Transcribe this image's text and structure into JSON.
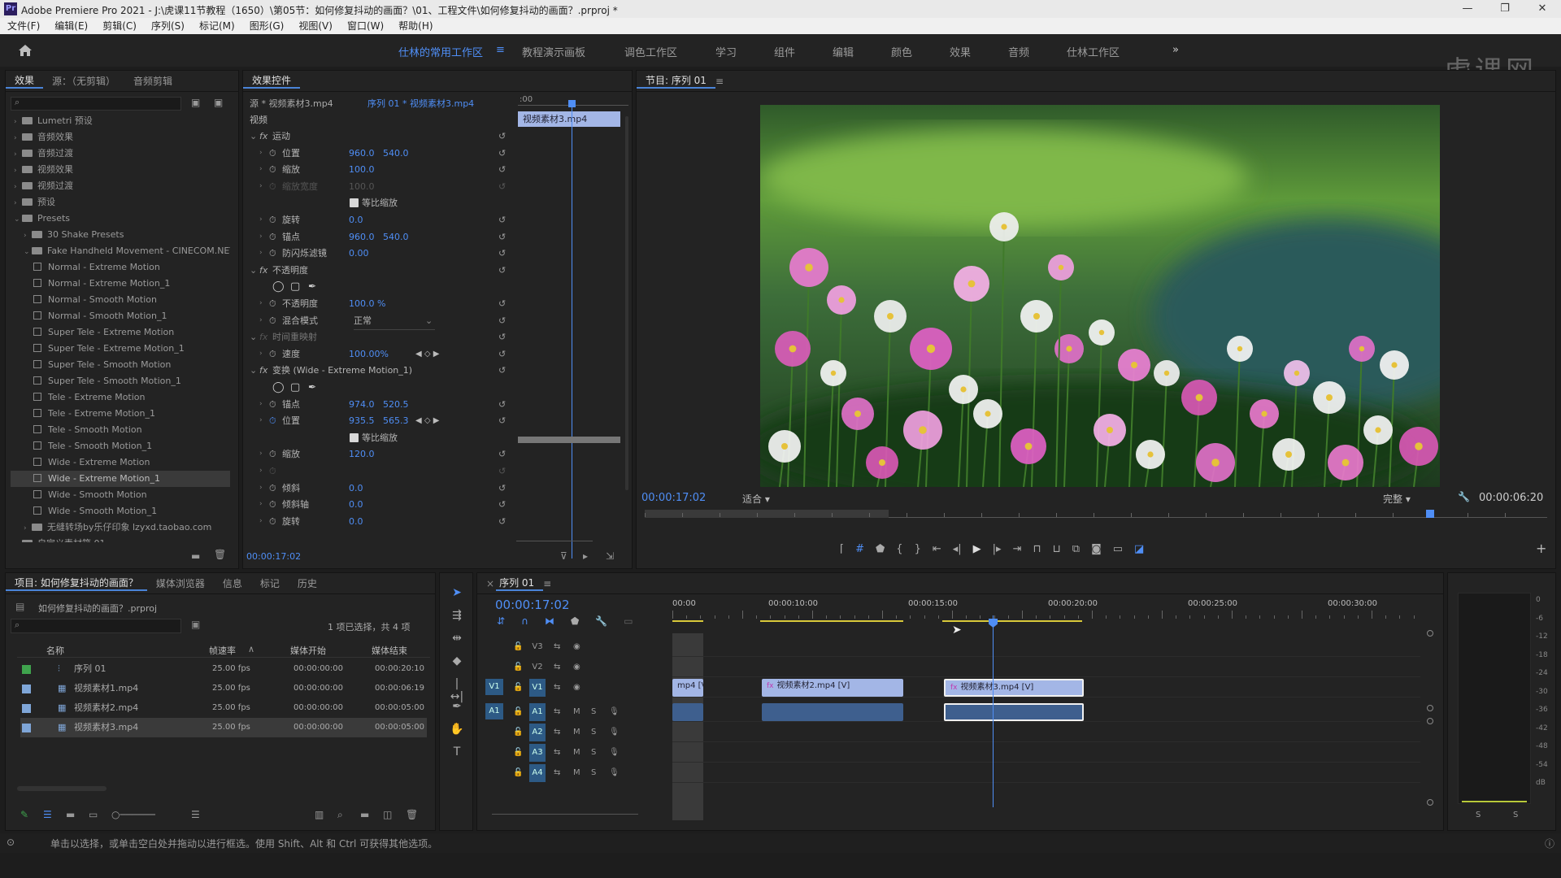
{
  "titlebar": {
    "app_icon": "Pr",
    "title": "Adobe Premiere Pro 2021 - J:\\虎课11节教程（1650）\\第05节：如何修复抖动的画面？\\01、工程文件\\如何修复抖动的画面？.prproj *",
    "controls": [
      "—",
      "❐",
      "✕"
    ]
  },
  "menu": [
    "文件(F)",
    "编辑(E)",
    "剪辑(C)",
    "序列(S)",
    "标记(M)",
    "图形(G)",
    "视图(V)",
    "窗口(W)",
    "帮助(H)"
  ],
  "workspaces": {
    "items": [
      "仕林的常用工作区",
      "教程演示画板",
      "调色工作区",
      "学习",
      "组件",
      "编辑",
      "颜色",
      "效果",
      "音频",
      "仕林工作区"
    ],
    "active": "仕林的常用工作区",
    "more": "»"
  },
  "watermark": "虎课网",
  "effects_panel": {
    "tabs": [
      "效果",
      "源：（无剪辑）",
      "音频剪辑"
    ],
    "tree": [
      {
        "label": "Lumetri 预设",
        "level": 0,
        "type": "folder"
      },
      {
        "label": "音频效果",
        "level": 0,
        "type": "folder"
      },
      {
        "label": "音频过渡",
        "level": 0,
        "type": "folder"
      },
      {
        "label": "视频效果",
        "level": 0,
        "type": "folder"
      },
      {
        "label": "视频过渡",
        "level": 0,
        "type": "folder"
      },
      {
        "label": "预设",
        "level": 0,
        "type": "folder"
      },
      {
        "label": "Presets",
        "level": 0,
        "type": "folder",
        "open": true
      },
      {
        "label": "30 Shake Presets",
        "level": 1,
        "type": "folder"
      },
      {
        "label": "Fake Handheld Movement - CINECOM.NET",
        "level": 1,
        "type": "folder",
        "open": true
      },
      {
        "label": "Normal - Extreme Motion",
        "level": 2,
        "type": "preset"
      },
      {
        "label": "Normal - Extreme Motion_1",
        "level": 2,
        "type": "preset"
      },
      {
        "label": "Normal - Smooth Motion",
        "level": 2,
        "type": "preset"
      },
      {
        "label": "Normal - Smooth Motion_1",
        "level": 2,
        "type": "preset"
      },
      {
        "label": "Super Tele - Extreme Motion",
        "level": 2,
        "type": "preset"
      },
      {
        "label": "Super Tele - Extreme Motion_1",
        "level": 2,
        "type": "preset"
      },
      {
        "label": "Super Tele - Smooth Motion",
        "level": 2,
        "type": "preset"
      },
      {
        "label": "Super Tele - Smooth Motion_1",
        "level": 2,
        "type": "preset"
      },
      {
        "label": "Tele - Extreme Motion",
        "level": 2,
        "type": "preset"
      },
      {
        "label": "Tele - Extreme Motion_1",
        "level": 2,
        "type": "preset"
      },
      {
        "label": "Tele - Smooth Motion",
        "level": 2,
        "type": "preset"
      },
      {
        "label": "Tele - Smooth Motion_1",
        "level": 2,
        "type": "preset"
      },
      {
        "label": "Wide - Extreme Motion",
        "level": 2,
        "type": "preset"
      },
      {
        "label": "Wide - Extreme Motion_1",
        "level": 2,
        "type": "preset",
        "selected": true
      },
      {
        "label": "Wide - Smooth Motion",
        "level": 2,
        "type": "preset"
      },
      {
        "label": "Wide - Smooth Motion_1",
        "level": 2,
        "type": "preset"
      },
      {
        "label": "无缝转场by乐仔印象 lzyxd.taobao.com",
        "level": 1,
        "type": "folder"
      },
      {
        "label": "自定义素材箱 01",
        "level": 0,
        "type": "folder"
      }
    ]
  },
  "effect_controls": {
    "tab": "效果控件",
    "source_label": "源 * 视频素材3.mp4",
    "sequence_label": "序列 01 * 视频素材3.mp4",
    "ruler_start": ":00",
    "clip_label": "视频素材3.mp4",
    "section_video": "视频",
    "timecode": "00:00:17:02",
    "rows": [
      {
        "label": "运动",
        "fx": true,
        "indent": 0
      },
      {
        "label": "位置",
        "v1": "960.0",
        "v2": "540.0",
        "indent": 1
      },
      {
        "label": "缩放",
        "v1": "100.0",
        "indent": 1
      },
      {
        "label": "缩放宽度",
        "v1": "100.0",
        "indent": 1,
        "disabled": true
      },
      {
        "label": "等比缩放",
        "checkbox": true,
        "indent": 2
      },
      {
        "label": "旋转",
        "v1": "0.0",
        "indent": 1
      },
      {
        "label": "锚点",
        "v1": "960.0",
        "v2": "540.0",
        "indent": 1
      },
      {
        "label": "防闪烁滤镜",
        "v1": "0.00",
        "indent": 1
      },
      {
        "label": "不透明度",
        "fx": true,
        "indent": 0
      },
      {
        "label": "",
        "masks": true,
        "indent": 1
      },
      {
        "label": "不透明度",
        "v1": "100.0 %",
        "indent": 1
      },
      {
        "label": "混合模式",
        "select": "正常",
        "indent": 1
      },
      {
        "label": "时间重映射",
        "fx": true,
        "indent": 0,
        "dim": true
      },
      {
        "label": "速度",
        "v1": "100.00%",
        "indent": 1,
        "keyframe": true
      },
      {
        "label": "变换 (Wide - Extreme Motion_1)",
        "fx": true,
        "indent": 0
      },
      {
        "label": "",
        "masks": true,
        "indent": 1
      },
      {
        "label": "锚点",
        "v1": "974.0",
        "v2": "520.5",
        "indent": 1
      },
      {
        "label": "位置",
        "v1": "935.5",
        "v2": "565.3",
        "indent": 1,
        "keyframe": true,
        "animated": true
      },
      {
        "label": "等比缩放",
        "checkbox": true,
        "indent": 2
      },
      {
        "label": "缩放",
        "v1": "120.0",
        "indent": 1
      },
      {
        "label": "",
        "v1": "",
        "indent": 1,
        "disabled": true
      },
      {
        "label": "倾斜",
        "v1": "0.0",
        "indent": 1
      },
      {
        "label": "倾斜轴",
        "v1": "0.0",
        "indent": 1
      },
      {
        "label": "旋转",
        "v1": "0.0",
        "indent": 1
      }
    ]
  },
  "program_monitor": {
    "tab": "节目: 序列 01",
    "timecode": "00:00:17:02",
    "fit": "适合",
    "quality": "完整",
    "duration": "00:00:06:20",
    "playhead_fraction": 0.87
  },
  "project_panel": {
    "tabs": [
      "项目: 如何修复抖动的画面？",
      "媒体浏览器",
      "信息",
      "标记",
      "历史"
    ],
    "project_file": "如何修复抖动的画面？.prproj",
    "selection_info": "1 项已选择，共 4 项",
    "columns": [
      "名称",
      "帧速率",
      "媒体开始",
      "媒体结束"
    ],
    "rows": [
      {
        "color": "#3fa34d",
        "name": "序列 01",
        "fps": "25.00 fps",
        "start": "00:00:00:00",
        "end": "00:00:20:10",
        "kind": "sequence"
      },
      {
        "color": "#7fa6d8",
        "name": "视频素材1.mp4",
        "fps": "25.00 fps",
        "start": "00:00:00:00",
        "end": "00:00:06:19",
        "kind": "clip"
      },
      {
        "color": "#7fa6d8",
        "name": "视频素材2.mp4",
        "fps": "25.00 fps",
        "start": "00:00:00:00",
        "end": "00:00:05:00",
        "kind": "clip"
      },
      {
        "color": "#7fa6d8",
        "name": "视频素材3.mp4",
        "fps": "25.00 fps",
        "start": "00:00:00:00",
        "end": "00:00:05:00",
        "kind": "clip",
        "selected": true
      }
    ]
  },
  "timeline": {
    "tab": "序列 01",
    "timecode": "00:00:17:02",
    "ruler": [
      "00:00",
      "00:00:10:00",
      "00:00:15:00",
      "00:00:20:00",
      "00:00:25:00",
      "00:00:30:00"
    ],
    "video_tracks": [
      "V3",
      "V2",
      "V1"
    ],
    "audio_tracks": [
      "A1",
      "A2",
      "A3",
      "A4"
    ],
    "source_video": "V1",
    "source_audio": "A1",
    "clip_v1_a": "mp4 [V]",
    "clip_v1_b": "视频素材2.mp4 [V]",
    "clip_v1_c": "视频素材3.mp4 [V]",
    "mute": "M",
    "solo": "S"
  },
  "audio_meter": {
    "scale": [
      "0",
      "-6",
      "-12",
      "-18",
      "-24",
      "-30",
      "-36",
      "-42",
      "-48",
      "-54",
      "dB"
    ],
    "solo_labels": [
      "S",
      "S"
    ]
  },
  "status_bar": "单击以选择，或单击空白处并拖动以进行框选。使用 Shift、Alt 和 Ctrl 可获得其他选项。"
}
